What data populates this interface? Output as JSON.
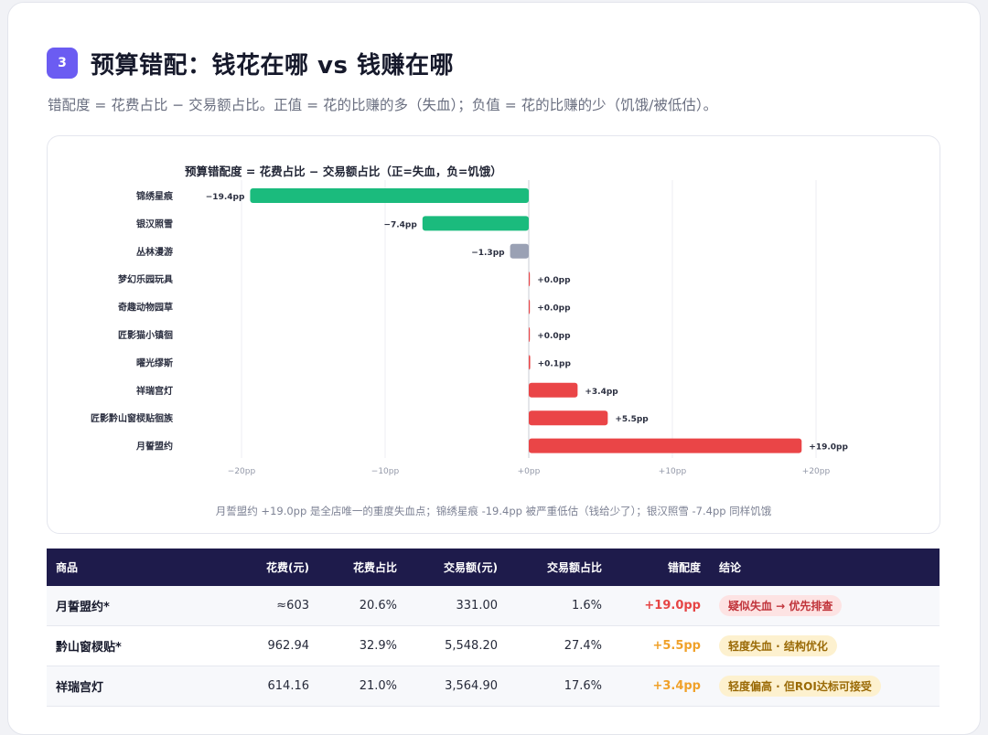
{
  "section": {
    "number": "3",
    "title": "预算错配：钱花在哪 vs 钱赚在哪",
    "subtitle": "错配度 = 花费占比 − 交易额占比。正值 = 花的比赚的多（失血）；负值 = 花的比赚的少（饥饿/被低估）。"
  },
  "colors": {
    "accent": "#6b5cf2",
    "negative_bar": "#1bbb7d",
    "neutral_bar": "#9aa1b4",
    "positive_bar": "#ea4547",
    "table_header": "#1e1b4b",
    "mismatch_high": "#e64545",
    "mismatch_mid": "#f0a12a",
    "pill_red_bg": "#fde3e3",
    "pill_red_fg": "#c0333a",
    "pill_yellow_bg": "#fdf1cf",
    "pill_yellow_fg": "#9a6a06"
  },
  "chart_data": {
    "type": "bar",
    "orientation": "horizontal",
    "title": "预算错配度 = 花费占比 − 交易额占比（正=失血，负=饥饿）",
    "categories": [
      "锦绣星痕",
      "银汉照雪",
      "丛林漫游",
      "梦幻乐园玩具",
      "奇趣动物园草",
      "匠影猫小镇徊",
      "曜光缪斯",
      "祥瑞宫灯",
      "匠影黔山窗棂贴徊族",
      "月誓盟约"
    ],
    "values": [
      -19.4,
      -7.4,
      -1.3,
      0.0,
      0.0,
      0.0,
      0.1,
      3.4,
      5.5,
      19.0
    ],
    "value_labels": [
      "−19.4pp",
      "−7.4pp",
      "−1.3pp",
      "+0.0pp",
      "+0.0pp",
      "+0.0pp",
      "+0.1pp",
      "+3.4pp",
      "+5.5pp",
      "+19.0pp"
    ],
    "xticks": [
      -20,
      -10,
      0,
      10,
      20
    ],
    "xtick_labels": [
      "−20pp",
      "−10pp",
      "+0pp",
      "+10pp",
      "+20pp"
    ],
    "xlim": [
      -20.5,
      20.5
    ],
    "grid": true,
    "note": "月誓盟约 +19.0pp 是全店唯一的重度失血点；锦绣星痕 -19.4pp 被严重低估（钱给少了）；银汉照雪 -7.4pp 同样饥饿"
  },
  "table": {
    "headers": [
      "商品",
      "花费(元)",
      "花费占比",
      "交易额(元)",
      "交易额占比",
      "错配度",
      "结论"
    ],
    "rows": [
      {
        "name": "月誓盟约*",
        "spend": "≈603",
        "spend_pct": "20.6%",
        "gmv": "331.00",
        "gmv_pct": "1.6%",
        "mismatch": "+19.0pp",
        "level": "high",
        "verdict": "疑似失血 → 优先排查"
      },
      {
        "name": "黔山窗棂贴*",
        "spend": "962.94",
        "spend_pct": "32.9%",
        "gmv": "5,548.20",
        "gmv_pct": "27.4%",
        "mismatch": "+5.5pp",
        "level": "mid",
        "verdict": "轻度失血 · 结构优化"
      },
      {
        "name": "祥瑞宫灯",
        "spend": "614.16",
        "spend_pct": "21.0%",
        "gmv": "3,564.90",
        "gmv_pct": "17.6%",
        "mismatch": "+3.4pp",
        "level": "mid",
        "verdict": "轻度偏高 · 但ROI达标可接受"
      }
    ]
  }
}
